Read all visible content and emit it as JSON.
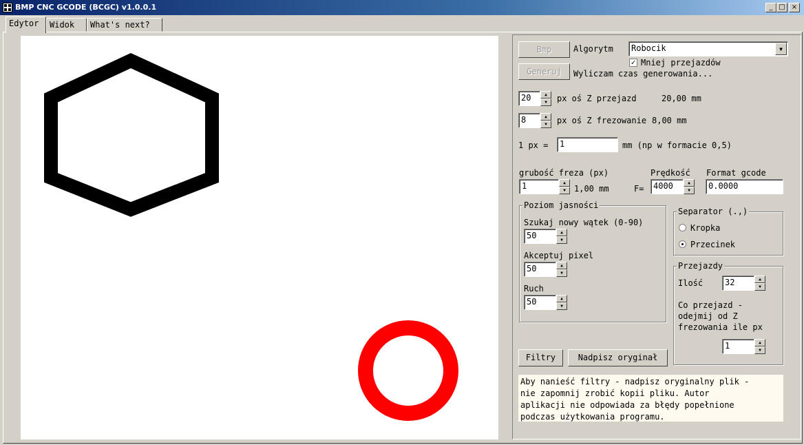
{
  "window": {
    "title": "BMP CNC GCODE (BCGC) v1.0.0.1",
    "controls": [
      "_",
      "□",
      "×"
    ]
  },
  "tabs": [
    {
      "label": "Edytor",
      "active": true
    },
    {
      "label": "Widok",
      "active": false
    },
    {
      "label": "What's next?",
      "active": false
    }
  ],
  "toolbar": {
    "bmp_button": "Bmp",
    "generuj_button": "Generuj",
    "algorithm_label": "Algorytm",
    "algorithm_value": "Robocik",
    "fewer_passes_label": "Mniej przejazdów",
    "fewer_passes_checked": true,
    "status_text": "Wyliczam czas generowania..."
  },
  "z_travel": {
    "value": "20",
    "label": "px oś Z przejazd",
    "mm": "20,00 mm"
  },
  "z_mill": {
    "value": "8",
    "label": "px oś Z frezowanie",
    "mm": "8,00 mm"
  },
  "scale": {
    "prefix": "1 px =",
    "value": "1",
    "suffix": "mm (np w formacie 0,5)"
  },
  "cutter": {
    "label": "grubość freza (px)",
    "value": "1",
    "mm": "1,00 mm"
  },
  "speed": {
    "label": "Prędkość",
    "prefix": "F=",
    "value": "4000"
  },
  "gcode_format": {
    "label": "Format gcode",
    "value": "0.0000"
  },
  "brightness": {
    "legend": "Poziom jasności",
    "search_label": "Szukaj nowy wątek (0-90)",
    "search_value": "50",
    "accept_label": "Akceptuj pixel",
    "accept_value": "50",
    "move_label": "Ruch",
    "move_value": "50"
  },
  "separator": {
    "legend": "Separator (.,)",
    "option_dot": "Kropka",
    "option_comma": "Przecinek",
    "selected": "Przecinek"
  },
  "passes": {
    "legend": "Przejazdy",
    "count_label": "Ilość",
    "count_value": "32",
    "subtract_label_1": "Co przejazd -",
    "subtract_label_2": "odejmij od Z",
    "subtract_label_3": "frezowania ile px",
    "subtract_value": "1"
  },
  "filters_button": "Filtry",
  "overwrite_button": "Nadpisz oryginał",
  "note": {
    "line1": "Aby nanieść filtry - nadpisz oryginalny plik -",
    "line2": "nie zapomnij zrobić kopii pliku. Autor",
    "line3": "aplikacji nie odpowiada za błędy popełnione",
    "line4": "podczas użytkowania programu."
  },
  "colors": {
    "hexagon": "#000000",
    "circle": "#ff0000",
    "canvas_bg": "#ffffff"
  }
}
